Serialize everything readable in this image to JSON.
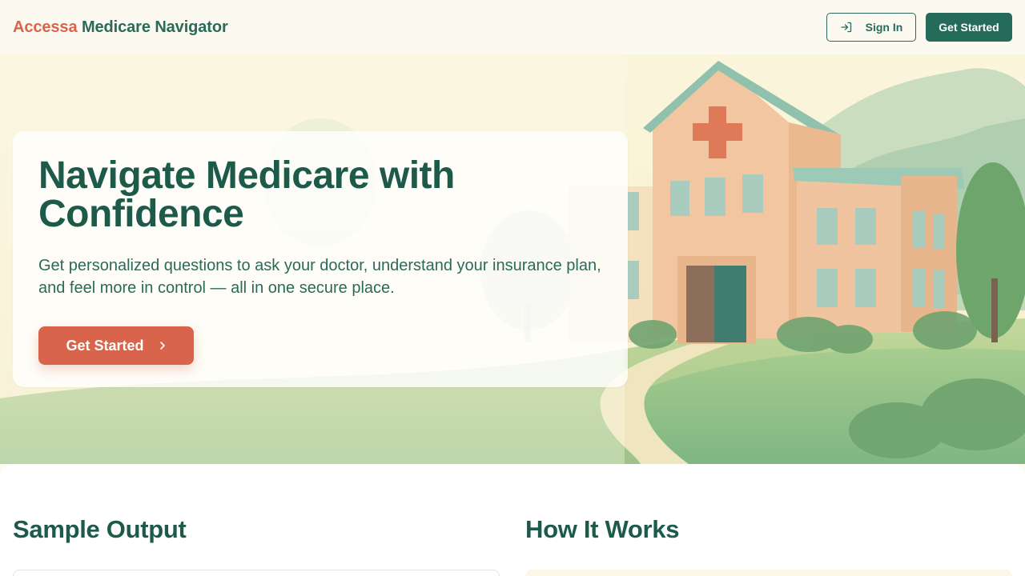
{
  "header": {
    "brand_part1": "Accessa",
    "brand_part2": "Medicare Navigator",
    "signin_label": "Sign In",
    "get_started_label": "Get Started",
    "signin_icon": "sign-in-icon"
  },
  "hero": {
    "title": "Navigate Medicare with Confidence",
    "subtitle": "Get personalized questions to ask your doctor, understand your insurance plan, and feel more in control — all in one secure place.",
    "cta_label": "Get Started",
    "cta_icon": "chevron-right-icon"
  },
  "sections": {
    "sample_title": "Sample Output",
    "how_title": "How It Works"
  },
  "colors": {
    "brand_accent": "#d9644c",
    "brand_primary": "#246b5a",
    "text_dark": "#1d5a4a"
  }
}
